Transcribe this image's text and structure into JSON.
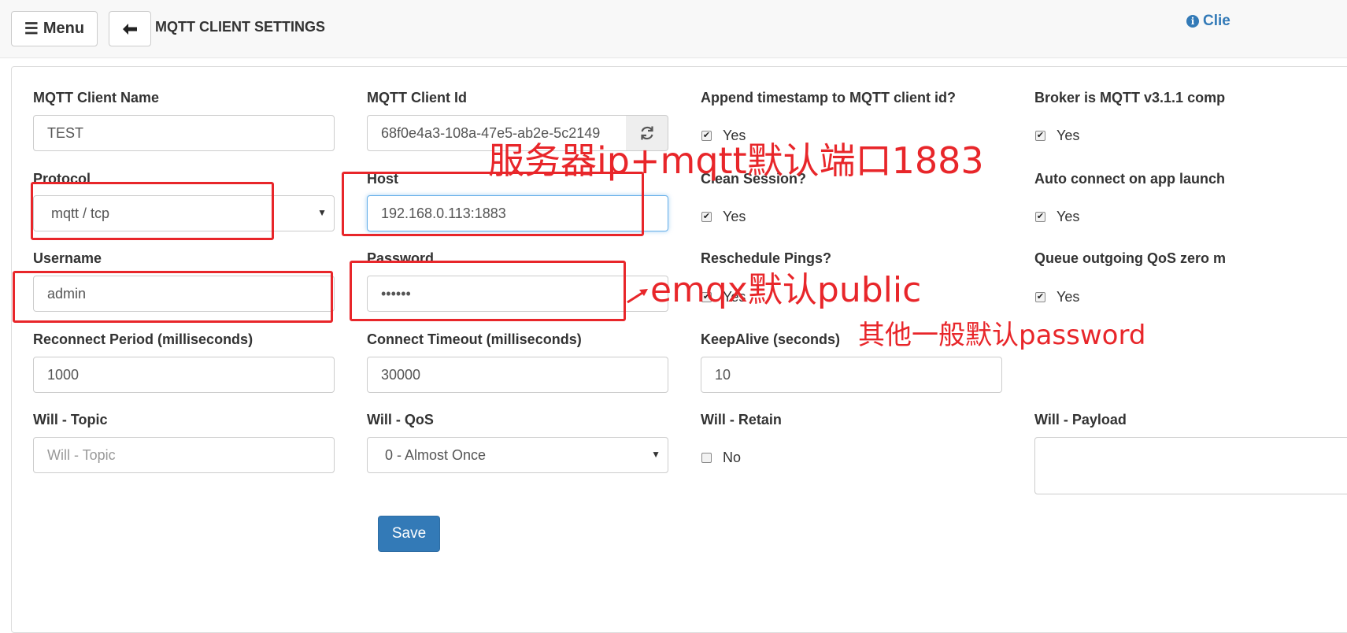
{
  "header": {
    "menu_label": "Menu",
    "menu_icon": "hamburger-icon",
    "back_icon": "arrow-left-icon",
    "title": "MQTT CLIENT SETTINGS",
    "right_link": "Clie",
    "right_icon": "info-icon",
    "link_color": "#337ab7"
  },
  "form": {
    "client_name": {
      "label": "MQTT Client Name",
      "value": "TEST"
    },
    "client_id": {
      "label": "MQTT Client Id",
      "value": "68f0e4a3-108a-47e5-ab2e-5c2149",
      "refresh_icon": "refresh-icon"
    },
    "append_timestamp": {
      "label": "Append timestamp to MQTT client id?",
      "option": "Yes",
      "checked": true
    },
    "broker_v311": {
      "label": "Broker is MQTT v3.1.1 comp",
      "option": "Yes",
      "checked": true
    },
    "protocol": {
      "label": "Protocol",
      "value": "mqtt / tcp"
    },
    "host": {
      "label": "Host",
      "value": "192.168.0.113:1883"
    },
    "clean_session": {
      "label": "Clean Session?",
      "option": "Yes",
      "checked": true
    },
    "auto_connect": {
      "label": "Auto connect on app launch",
      "option": "Yes",
      "checked": true
    },
    "username": {
      "label": "Username",
      "value": "admin"
    },
    "password": {
      "label": "Password",
      "value": "••••••"
    },
    "reschedule_pings": {
      "label": "Reschedule Pings?",
      "option": "Yes",
      "checked": true
    },
    "queue_outgoing": {
      "label": "Queue outgoing QoS zero m",
      "option": "Yes",
      "checked": true
    },
    "reconnect_period": {
      "label": "Reconnect Period (milliseconds)",
      "value": "1000"
    },
    "connect_timeout": {
      "label": "Connect Timeout (milliseconds)",
      "value": "30000"
    },
    "keepalive": {
      "label": "KeepAlive (seconds)",
      "value": "10"
    },
    "will_topic": {
      "label": "Will - Topic",
      "placeholder": "Will - Topic"
    },
    "will_qos": {
      "label": "Will - QoS",
      "value": "0 - Almost Once"
    },
    "will_retain": {
      "label": "Will - Retain",
      "option": "No",
      "checked": false
    },
    "will_payload": {
      "label": "Will - Payload",
      "value": ""
    },
    "save_label": "Save",
    "primary_color": "#337ab7"
  },
  "annotations": {
    "host_note": "服务器ip+mqtt默认端口1883",
    "password_note": "emqx默认public",
    "password_note2": "其他一般默认password",
    "color": "#e8262a"
  }
}
